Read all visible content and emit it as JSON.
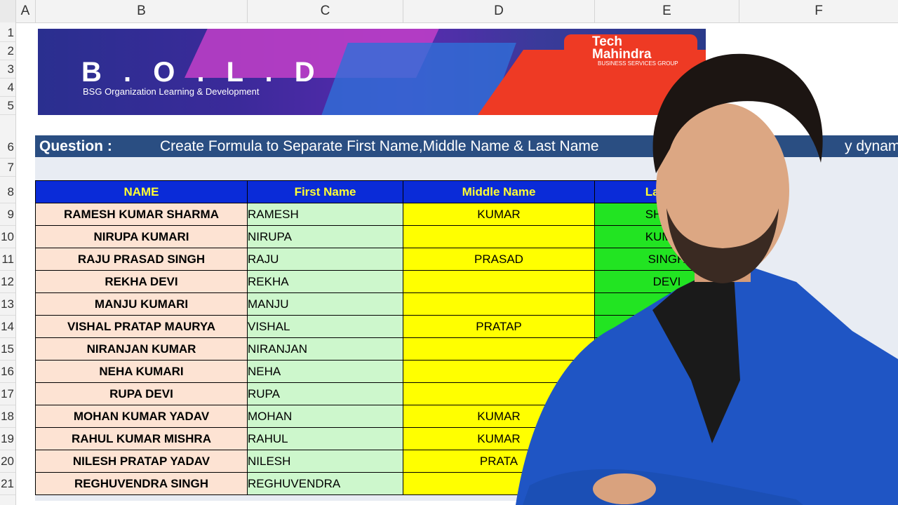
{
  "columns": [
    "A",
    "B",
    "C",
    "D",
    "E",
    "F"
  ],
  "rows": [
    "1",
    "2",
    "3",
    "4",
    "5",
    "6",
    "7",
    "8",
    "9",
    "10",
    "11",
    "12",
    "13",
    "14",
    "15",
    "16",
    "17",
    "18",
    "19",
    "20",
    "21"
  ],
  "banner": {
    "title": "B . O . L . D",
    "subtitle": "BSG Organization Learning & Development",
    "logo_line1": "Tech",
    "logo_line2": "Mahindra",
    "logo_tag": "BUSINESS SERVICES GROUP"
  },
  "question": {
    "label": "Question :",
    "text": "Create Formula to Separate First Name,Middle Name & Last Name",
    "text_tail": "y dynamic"
  },
  "table": {
    "headers": [
      "NAME",
      "First Name",
      "Middle Name",
      "Last Na"
    ],
    "rows": [
      {
        "name": "RAMESH KUMAR SHARMA",
        "first": "RAMESH",
        "middle": "KUMAR",
        "last": "SHARM"
      },
      {
        "name": "NIRUPA KUMARI",
        "first": "NIRUPA",
        "middle": "",
        "last": "KUMAR"
      },
      {
        "name": "RAJU PRASAD SINGH",
        "first": "RAJU",
        "middle": "PRASAD",
        "last": "SINGH"
      },
      {
        "name": "REKHA DEVI",
        "first": "REKHA",
        "middle": "",
        "last": "DEVI"
      },
      {
        "name": "MANJU KUMARI",
        "first": "MANJU",
        "middle": "",
        "last": ""
      },
      {
        "name": "VISHAL PRATAP MAURYA",
        "first": "VISHAL",
        "middle": "PRATAP",
        "last": ""
      },
      {
        "name": "NIRANJAN KUMAR",
        "first": "NIRANJAN",
        "middle": "",
        "last": ""
      },
      {
        "name": "NEHA KUMARI",
        "first": "NEHA",
        "middle": "",
        "last": ""
      },
      {
        "name": "RUPA DEVI",
        "first": "RUPA",
        "middle": "",
        "last": ""
      },
      {
        "name": "MOHAN KUMAR YADAV",
        "first": "MOHAN",
        "middle": "KUMAR",
        "last": ""
      },
      {
        "name": "RAHUL KUMAR MISHRA",
        "first": "RAHUL",
        "middle": "KUMAR",
        "last": ""
      },
      {
        "name": "NILESH PRATAP YADAV",
        "first": "NILESH",
        "middle": "PRATA",
        "last": ""
      },
      {
        "name": "REGHUVENDRA SINGH",
        "first": "REGHUVENDRA",
        "middle": "",
        "last": ""
      }
    ]
  },
  "colors": {
    "header_bg": "#0a2bd8",
    "header_text": "#ffff33",
    "question_bar": "#2a4e82",
    "name_fill": "#fde3d3",
    "first_fill": "#cdf7cc",
    "middle_fill": "#ffff00",
    "last_fill": "#22e422"
  }
}
